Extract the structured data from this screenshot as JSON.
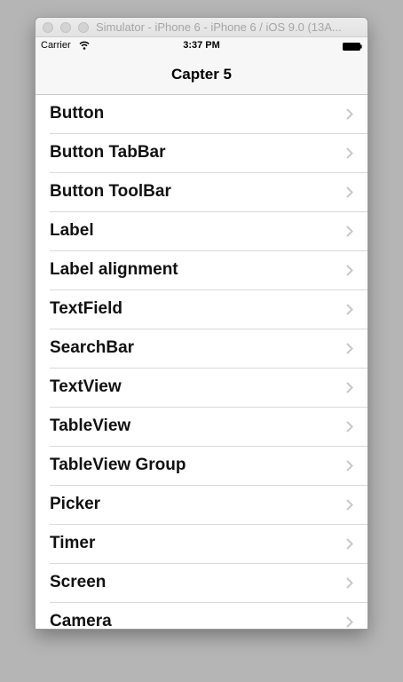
{
  "window": {
    "title": "Simulator - iPhone 6 - iPhone 6 / iOS 9.0 (13A..."
  },
  "status_bar": {
    "carrier": "Carrier",
    "time": "3:37 PM"
  },
  "nav": {
    "title": "Capter 5"
  },
  "list": {
    "items": [
      "Button",
      "Button TabBar",
      "Button ToolBar",
      "Label",
      "Label alignment",
      "TextField",
      "SearchBar",
      "TextView",
      "TableView",
      "TableView Group",
      "Picker",
      "Timer",
      "Screen",
      "Camera"
    ]
  },
  "icons": {
    "row_accessory": "chevron-right-icon",
    "status_wifi": "wifi-icon",
    "status_battery": "battery-icon"
  },
  "colors": {
    "desktop": "#b5b5b5",
    "chevron": "#c7c7cc",
    "separator": "#d9d9dc"
  }
}
